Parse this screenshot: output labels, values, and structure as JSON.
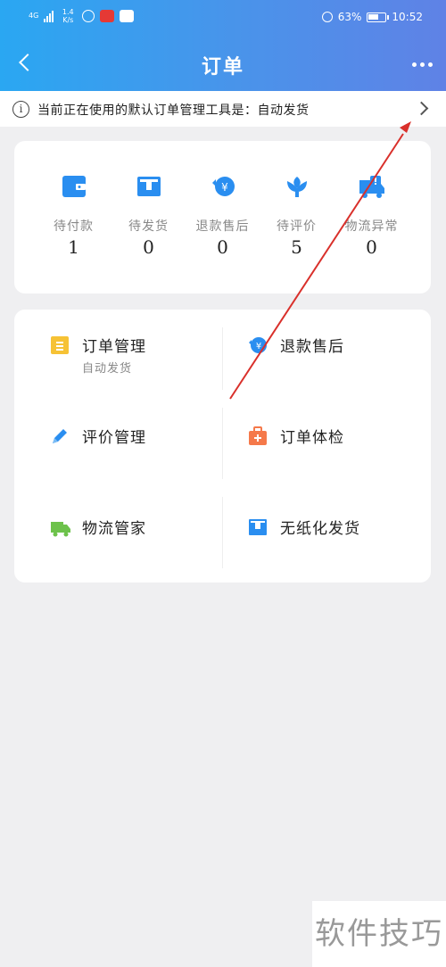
{
  "statusbar": {
    "network": "4G",
    "speed_top": "1.4",
    "speed_bottom": "K/s",
    "battery": "63%",
    "time": "10:52"
  },
  "nav": {
    "title": "订单",
    "back_icon": "chevron-left-icon",
    "more_icon": "more-dots-icon"
  },
  "notice": {
    "text": "当前正在使用的默认订单管理工具是：自动发货",
    "icon": "info-icon"
  },
  "order_status": [
    {
      "label": "待付款",
      "count": "1",
      "icon": "wallet-icon",
      "color": "#2a8ef0"
    },
    {
      "label": "待发货",
      "count": "0",
      "icon": "box-icon",
      "color": "#2a8ef0"
    },
    {
      "label": "退款售后",
      "count": "0",
      "icon": "refund-yuan-icon",
      "color": "#2a8ef0"
    },
    {
      "label": "待评价",
      "count": "5",
      "icon": "flower-icon",
      "color": "#2a8ef0"
    },
    {
      "label": "物流异常",
      "count": "0",
      "icon": "truck-alert-icon",
      "color": "#2a8ef0"
    }
  ],
  "tools": [
    {
      "label": "订单管理",
      "sub": "自动发货",
      "icon": "document-icon",
      "color": "#f6c235"
    },
    {
      "label": "退款售后",
      "sub": "",
      "icon": "refund-yuan-icon",
      "color": "#2a8ef0"
    },
    {
      "label": "评价管理",
      "sub": "",
      "icon": "pencil-icon",
      "color": "#2a8ef0"
    },
    {
      "label": "订单体检",
      "sub": "",
      "icon": "medical-kit-icon",
      "color": "#f5794a"
    },
    {
      "label": "物流管家",
      "sub": "",
      "icon": "truck-icon",
      "color": "#6dc24b"
    },
    {
      "label": "无纸化发货",
      "sub": "",
      "icon": "box-icon",
      "color": "#2a8ef0"
    }
  ],
  "watermark": "软件技巧"
}
